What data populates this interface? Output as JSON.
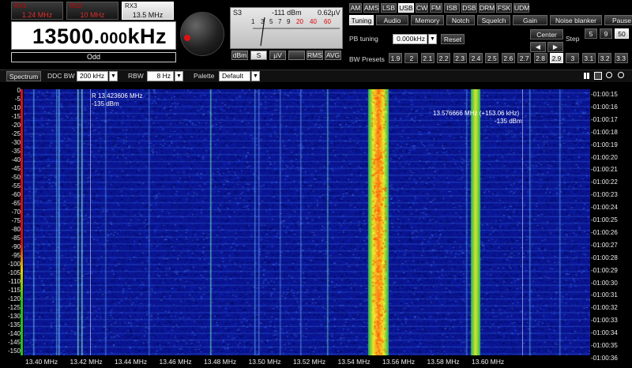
{
  "receivers": [
    {
      "title": "RX1",
      "freq": "1.24 MHz",
      "active": false
    },
    {
      "title": "RX2",
      "freq": "10 MHz",
      "active": false
    },
    {
      "title": "RX3",
      "freq": "13.5 MHz",
      "active": true
    }
  ],
  "frequency": {
    "main": "13500.",
    "fraction": "000",
    "unit": "kHz",
    "sideband_label": "Odd"
  },
  "smeter": {
    "s_value": "S3",
    "dbm": "-111 dBm",
    "uv": "0.62µV",
    "scale": [
      "1",
      "3",
      "5",
      "7",
      "9",
      "20",
      "40",
      "60"
    ],
    "buttons": [
      "dBm",
      "S",
      "µV",
      "RMS",
      "AVG"
    ],
    "active_button": "S"
  },
  "modes": [
    "AM",
    "AMS",
    "LSB",
    "USB",
    "CW",
    "FM",
    "ISB",
    "DSB",
    "DRM",
    "FSK",
    "UDM"
  ],
  "active_mode": "USB",
  "function_tabs": [
    "Tuning",
    "Audio",
    "Memory",
    "Notch",
    "Squelch",
    "Gain",
    "Noise blanker",
    "Pause"
  ],
  "active_function": "Tuning",
  "pb_tuning": {
    "label": "PB tuning",
    "value": "0.000kHz",
    "reset": "Reset"
  },
  "center_label": "Center",
  "step": {
    "label": "Step",
    "options": [
      "5",
      "9",
      "50"
    ],
    "selected": "50"
  },
  "bw_presets": {
    "label": "BW Presets",
    "values": [
      "1.9",
      "2",
      "2.1",
      "2.2",
      "2.3",
      "2.4",
      "2.5",
      "2.6",
      "2.7",
      "2.8",
      "2.9",
      "3",
      "3.1",
      "3.2",
      "3.3"
    ],
    "selected": "2.9"
  },
  "toolbar": {
    "spectrum": "Spectrum",
    "ddc_label": "DDC BW",
    "ddc_value": "200 kHz",
    "rbw_label": "RBW",
    "rbw_value": "8 Hz",
    "palette_label": "Palette",
    "palette_value": "Default"
  },
  "yaxis": [
    "0",
    "-5",
    "-10",
    "-15",
    "-20",
    "-25",
    "-30",
    "-35",
    "-40",
    "-45",
    "-50",
    "-55",
    "-60",
    "-65",
    "-70",
    "-75",
    "-80",
    "-85",
    "-90",
    "-95",
    "-100",
    "-105",
    "-110",
    "-115",
    "-120",
    "-125",
    "-130",
    "-135",
    "-140",
    "-145",
    "-150"
  ],
  "xaxis": [
    "13.40 MHz",
    "13.42 MHz",
    "13.44 MHz",
    "13.46 MHz",
    "13.48 MHz",
    "13.50 MHz",
    "13.52 MHz",
    "13.54 MHz",
    "13.56 MHz",
    "13.58 MHz",
    "13.60 MHz"
  ],
  "times": [
    "-01:00:15",
    "-01:00:16",
    "-01:00:17",
    "-01:00:18",
    "-01:00:19",
    "-01:00:20",
    "-01:00:21",
    "-01:00:22",
    "-01:00:23",
    "-01:00:24",
    "-01:00:25",
    "-01:00:26",
    "-01:00:27",
    "-01:00:28",
    "-01:00:29",
    "-01:00:30",
    "-01:00:31",
    "-01:00:32",
    "-01:00:33",
    "-01:00:34",
    "-01:00:35",
    "-01:00:36"
  ],
  "cursor_a": {
    "freq": "R 13.423606 MHz",
    "level": "-135 dBm"
  },
  "cursor_b": {
    "freq": "13.576666 MHz (+153.06 kHz)",
    "level": "-135 dBm"
  }
}
